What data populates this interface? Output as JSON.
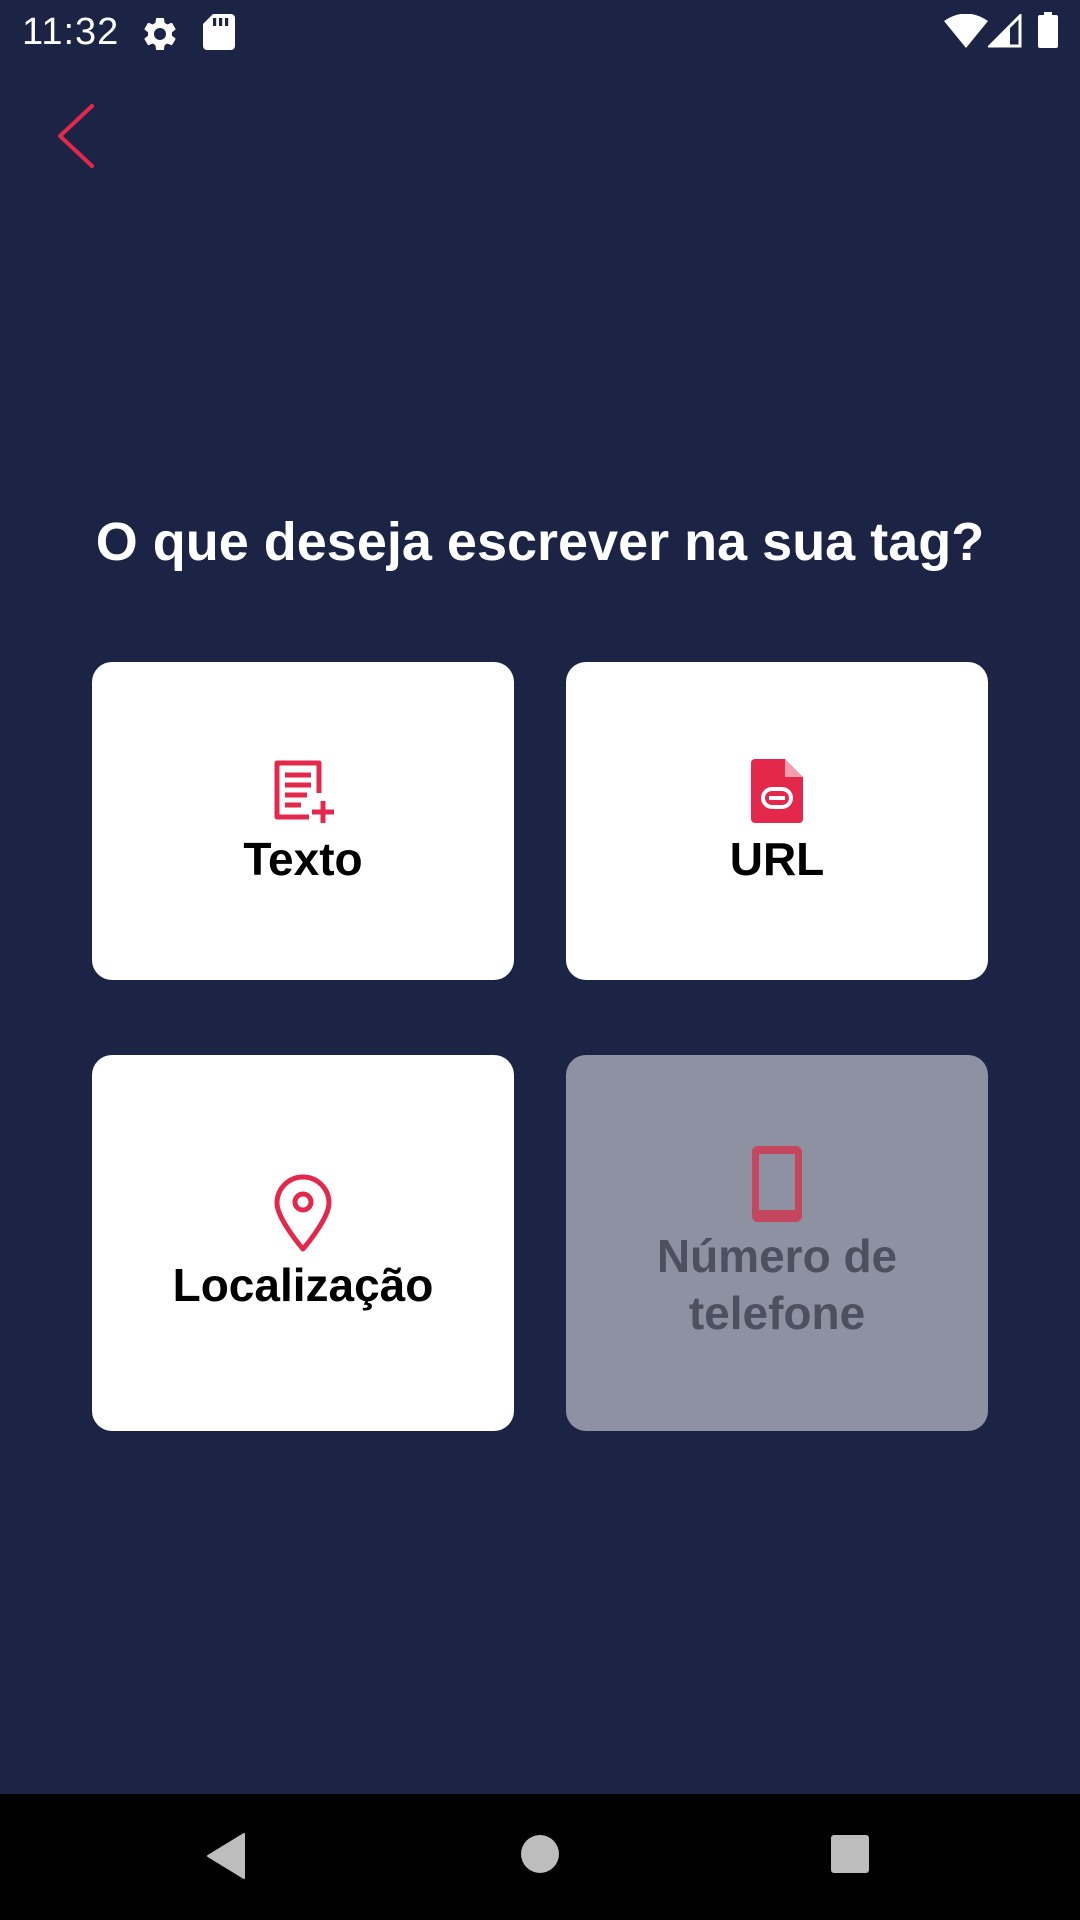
{
  "status_bar": {
    "time": "11:32",
    "icons": [
      "gear-icon",
      "sd-card-icon",
      "wifi-icon",
      "cell-signal-icon",
      "battery-icon"
    ]
  },
  "header": {
    "back_icon": "chevron-left-icon"
  },
  "main": {
    "question": "O que deseja escrever na sua tag?",
    "options": [
      {
        "label": "Texto",
        "icon": "text-add-icon",
        "enabled": true
      },
      {
        "label": "URL",
        "icon": "link-file-icon",
        "enabled": true
      },
      {
        "label": "Localização",
        "icon": "location-pin-icon",
        "enabled": true
      },
      {
        "label": "Número de telefone",
        "icon": "phone-icon",
        "enabled": false
      }
    ]
  },
  "nav_bar": {
    "icons": [
      "back-triangle-icon",
      "home-circle-icon",
      "recents-square-icon"
    ]
  },
  "colors": {
    "background": "#1b2444",
    "accent": "#e3284b",
    "card": "#ffffff",
    "card_disabled": "#8d91a1",
    "text_disabled": "#4e5060"
  }
}
